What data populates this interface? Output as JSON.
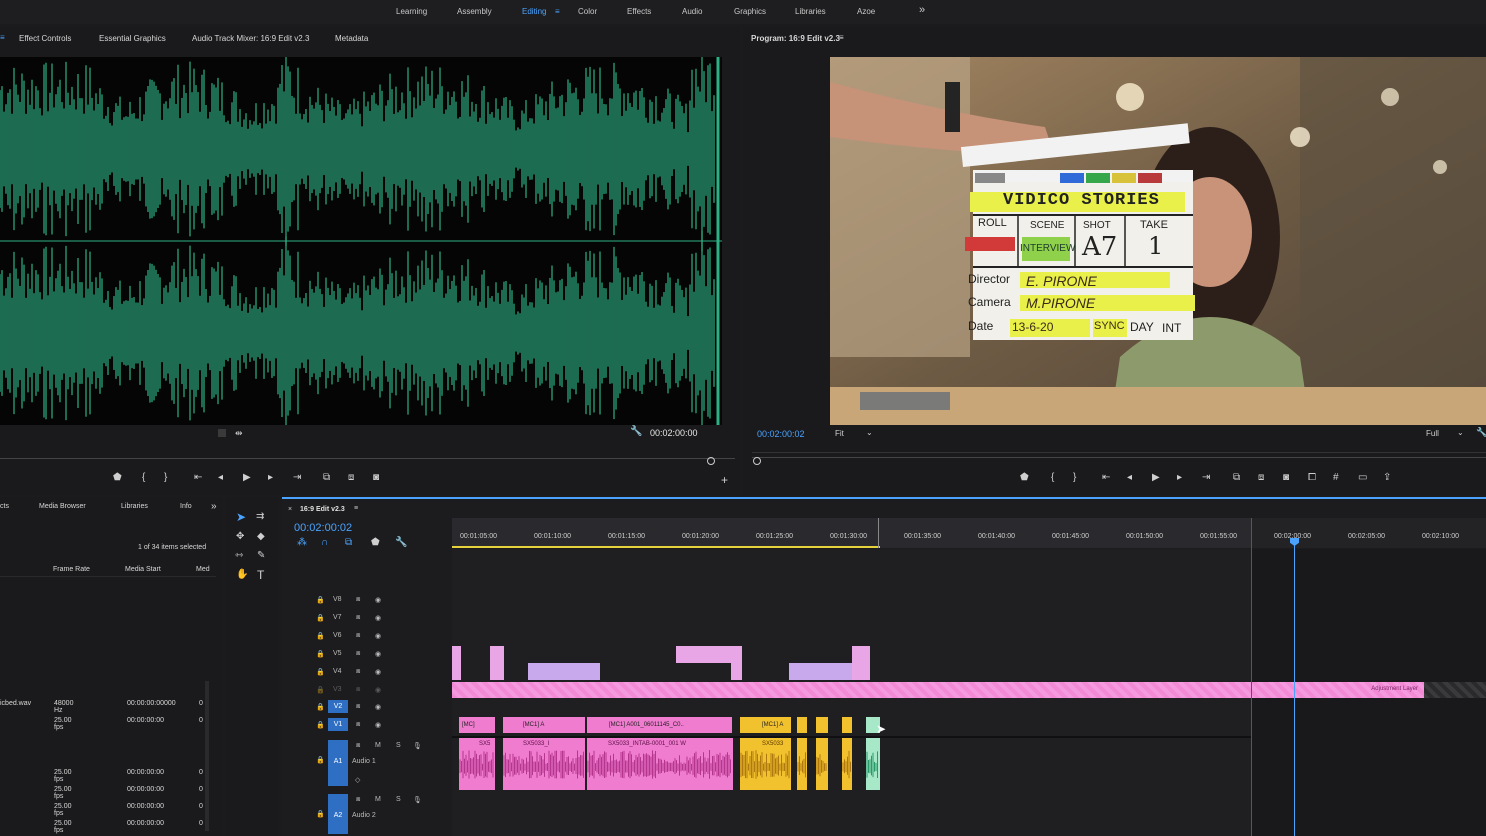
{
  "workspaces": [
    "Learning",
    "Assembly",
    "Editing",
    "Color",
    "Effects",
    "Audio",
    "Graphics",
    "Libraries",
    "Azoe"
  ],
  "active_workspace": "Editing",
  "more_icon": "»",
  "source_tabs": [
    "Effect Controls",
    "Essential Graphics",
    "Audio Track Mixer: 16:9 Edit v2.3",
    "Metadata"
  ],
  "source_timecode": "00:02:00:00",
  "program_title": "Program: 16:9 Edit v2.3",
  "program_timecode": "00:02:00:02",
  "program_fit": "Fit",
  "program_quality": "Full",
  "clapper": {
    "title": "VIDICO STORIES",
    "roll_label": "ROLL",
    "scene_label": "SCENE",
    "scene_value": "INTERVIEW",
    "shot_label": "SHOT",
    "shot_value": "A7",
    "take_label": "TAKE",
    "take_value": "1",
    "director_label": "Director",
    "director_value": "E. PIRONE",
    "camera_label": "Camera",
    "camera_value": "M.PIRONE",
    "date_label": "Date",
    "date_value": "13-6-20",
    "sync_label": "SYNC",
    "day_label": "DAY",
    "int_label": "INT"
  },
  "project": {
    "tabs": [
      "cts",
      "Media Browser",
      "Libraries",
      "Info"
    ],
    "selection": "1 of 34 items selected",
    "columns": [
      "Frame Rate",
      "Media Start",
      "Med"
    ],
    "rows": [
      {
        "name": "icbed.wav",
        "rate": "48000 Hz",
        "start": "00:00:00:00000",
        "m": "0"
      },
      {
        "name": "",
        "rate": "25.00 fps",
        "start": "00:00:00:00",
        "m": "0"
      },
      {
        "name": "",
        "rate": "25.00 fps",
        "start": "00:00:00:00",
        "m": "0"
      },
      {
        "name": "",
        "rate": "25.00 fps",
        "start": "00:00:00:00",
        "m": "0"
      },
      {
        "name": "",
        "rate": "25.00 fps",
        "start": "00:00:00:00",
        "m": "0"
      },
      {
        "name": "",
        "rate": "25.00 fps",
        "start": "00:00:00:00",
        "m": "0"
      }
    ]
  },
  "timeline": {
    "title": "16:9 Edit v2.3",
    "timecode": "00:02:00:02",
    "ruler": [
      "00:01:05:00",
      "00:01:10:00",
      "00:01:15:00",
      "00:01:20:00",
      "00:01:25:00",
      "00:01:30:00",
      "00:01:35:00",
      "00:01:40:00",
      "00:01:45:00",
      "00:01:50:00",
      "00:01:55:00",
      "00:02:00:00",
      "00:02:05:00",
      "00:02:10:00"
    ],
    "video_tracks": [
      "V8",
      "V7",
      "V6",
      "V5",
      "V4",
      "V3",
      "V2",
      "V1"
    ],
    "audio_tracks": [
      {
        "id": "A1",
        "name": "Audio 1"
      },
      {
        "id": "A2",
        "name": "Audio 2"
      }
    ],
    "clip_labels": {
      "adjustment": "Adjustment Layer",
      "mc1": "[MC]",
      "mc1a": "[MC1] A",
      "mc1b": "[MC1] A001_06011145_C0..",
      "mc1y": "[MC1] A",
      "sx1": "SX5",
      "sx2": "SX5033_I",
      "sx3": "SX5033_INTAB-0001_001 W",
      "sx4": "SX5033"
    }
  },
  "colors": {
    "accent": "#4aa3ff",
    "waveform": "#2db184",
    "pink": "#f07ccf",
    "video_pink": "#e9a6e6",
    "yellow": "#f2c12e",
    "adjust": "#f38ad6"
  },
  "icons": [
    "selection-tool-icon",
    "track-select-icon",
    "ripple-edit-icon",
    "razor-icon",
    "slip-icon",
    "pen-icon",
    "hand-icon",
    "type-icon",
    "wrench-icon",
    "marker-icon",
    "play-icon",
    "camera-icon"
  ]
}
